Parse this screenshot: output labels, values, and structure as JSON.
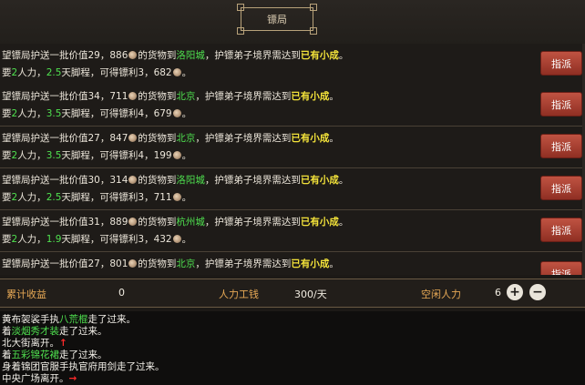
{
  "header": {
    "title": "镖局"
  },
  "missions": [
    {
      "value": "29，886",
      "destination": "洛阳城",
      "rank": "已有小成",
      "people": "2",
      "days": "2.5",
      "profit": "3，682"
    },
    {
      "value": "34，711",
      "destination": "北京",
      "rank": "已有小成",
      "people": "2",
      "days": "3.5",
      "profit": "4，679"
    },
    {
      "value": "27，847",
      "destination": "北京",
      "rank": "已有小成",
      "people": "2",
      "days": "3.5",
      "profit": "4，199"
    },
    {
      "value": "30，314",
      "destination": "洛阳城",
      "rank": "已有小成",
      "people": "2",
      "days": "2.5",
      "profit": "3，711"
    },
    {
      "value": "31，889",
      "destination": "杭州城",
      "rank": "已有小成",
      "people": "2",
      "days": "1.9",
      "profit": "3，432"
    },
    {
      "value": "27，801",
      "destination": "北京",
      "rank": "已有小成",
      "people": "",
      "days": "",
      "profit": ""
    }
  ],
  "text": {
    "prefix": "望镖局护送一批价值",
    "goods_to": "的货物到",
    "requirement": "，护镖弟子境界需达到",
    "period": "。",
    "need": "要",
    "manpower": "人力，",
    "days_suffix": "天脚程，可得镖利",
    "assign": "指派"
  },
  "stats": {
    "earnings_label": "累计收益",
    "earnings_value": "0",
    "wage_label": "人力工钱",
    "wage_value": "300/天",
    "idle_label": "空闲人力",
    "idle_value": "6"
  },
  "log": [
    {
      "a": "黄布袈裟手执",
      "b": "八荒棍",
      "c": "走了过来。"
    },
    {
      "a": "着",
      "b": "淡烟秀才装",
      "c": "走了过来。"
    },
    {
      "a": "北大街离开。",
      "arrow": "↑"
    },
    {
      "a": "着",
      "b": "五彩锦花裙",
      "c": "走了过来。"
    },
    {
      "a": "身着锦团官服手执官府用剑走了过来。"
    },
    {
      "a": "中央广场离开。",
      "arrow": "→"
    }
  ],
  "colors": {
    "highlight_green": "#4fe04f",
    "rank_yellow": "#f2e23a",
    "button_red": "#a8402f",
    "label_orange": "#e6a855"
  },
  "icons": {
    "coin": "coin-icon",
    "plus": "plus-icon",
    "minus": "minus-icon"
  }
}
